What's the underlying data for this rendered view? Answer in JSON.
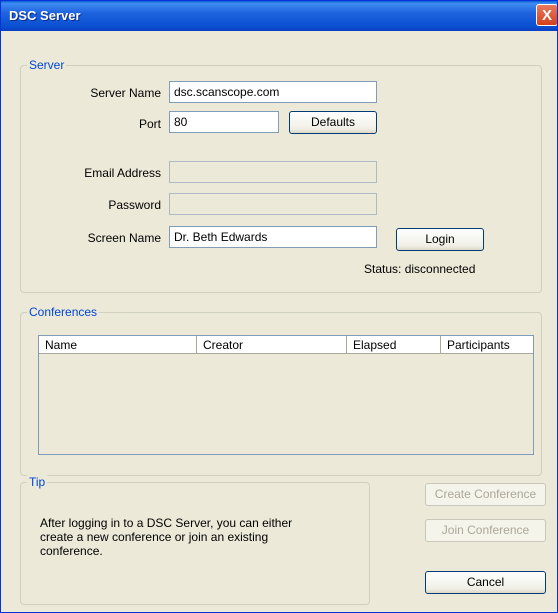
{
  "window": {
    "title": "DSC Server",
    "close_label": "X"
  },
  "server": {
    "legend": "Server",
    "server_name_label": "Server Name",
    "server_name_value": "dsc.scanscope.com",
    "port_label": "Port",
    "port_value": "80",
    "defaults_label": "Defaults",
    "email_label": "Email Address",
    "email_value": "",
    "password_label": "Password",
    "password_value": "",
    "screen_name_label": "Screen Name",
    "screen_name_value": "Dr. Beth Edwards",
    "login_label": "Login",
    "status_text": "Status: disconnected"
  },
  "conferences": {
    "legend": "Conferences",
    "columns": [
      "Name",
      "Creator",
      "Elapsed",
      "Participants"
    ]
  },
  "tip": {
    "legend": "Tip",
    "text_line1": "After logging in to a DSC Server, you can either",
    "text_line2": "create a new conference or join an existing",
    "text_line3": "conference."
  },
  "actions": {
    "create_label": "Create Conference",
    "join_label": "Join Conference",
    "cancel_label": "Cancel"
  },
  "colors": {
    "title_bar": "#0a4fd0",
    "group_legend": "#0046d5",
    "dialog_bg": "#ece9d8"
  }
}
